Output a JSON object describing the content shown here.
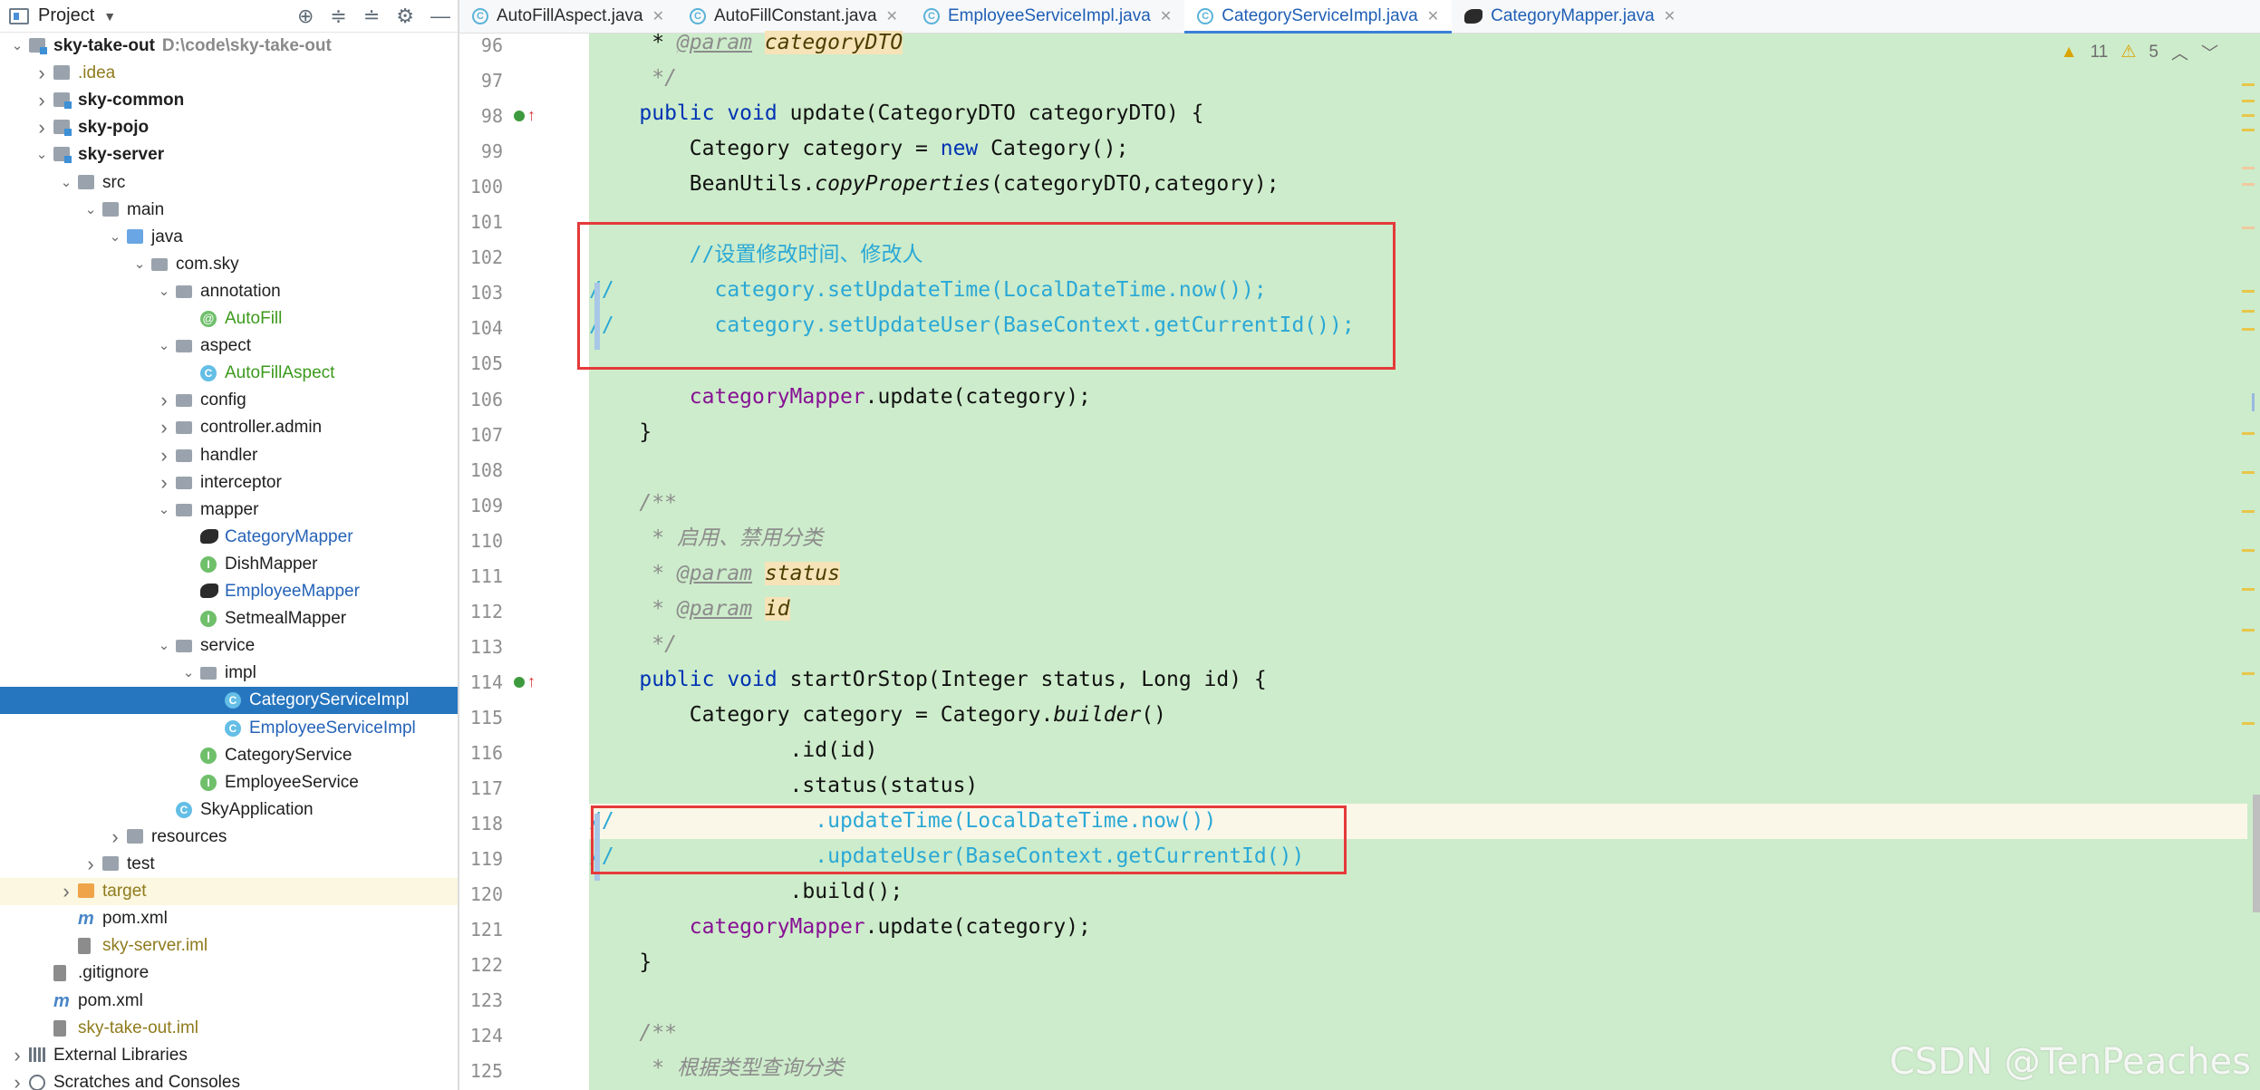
{
  "project_panel": {
    "title": "Project",
    "tree": [
      {
        "label": "sky-take-out",
        "path": "D:\\code\\sky-take-out",
        "indent": 0,
        "arrow": "down",
        "icon": "module-folder-icon",
        "style": "bold"
      },
      {
        "label": ".idea",
        "indent": 1,
        "arrow": "right",
        "icon": "folder-icon",
        "style": "brown"
      },
      {
        "label": "sky-common",
        "indent": 1,
        "arrow": "right",
        "icon": "module-folder-icon",
        "style": "bold"
      },
      {
        "label": "sky-pojo",
        "indent": 1,
        "arrow": "right",
        "icon": "module-folder-icon",
        "style": "bold"
      },
      {
        "label": "sky-server",
        "indent": 1,
        "arrow": "down",
        "icon": "module-folder-icon",
        "style": "bold"
      },
      {
        "label": "src",
        "indent": 2,
        "arrow": "down",
        "icon": "folder-icon",
        "style": ""
      },
      {
        "label": "main",
        "indent": 3,
        "arrow": "down",
        "icon": "folder-icon",
        "style": ""
      },
      {
        "label": "java",
        "indent": 4,
        "arrow": "down",
        "icon": "source-folder-icon",
        "style": ""
      },
      {
        "label": "com.sky",
        "indent": 5,
        "arrow": "down",
        "icon": "package-icon",
        "style": ""
      },
      {
        "label": "annotation",
        "indent": 6,
        "arrow": "down",
        "icon": "package-icon",
        "style": ""
      },
      {
        "label": "AutoFill",
        "indent": 7,
        "arrow": "",
        "icon": "annotation-icon",
        "style": "green"
      },
      {
        "label": "aspect",
        "indent": 6,
        "arrow": "down",
        "icon": "package-icon",
        "style": ""
      },
      {
        "label": "AutoFillAspect",
        "indent": 7,
        "arrow": "",
        "icon": "class-icon",
        "style": "green"
      },
      {
        "label": "config",
        "indent": 6,
        "arrow": "right",
        "icon": "package-icon",
        "style": ""
      },
      {
        "label": "controller.admin",
        "indent": 6,
        "arrow": "right",
        "icon": "package-icon",
        "style": ""
      },
      {
        "label": "handler",
        "indent": 6,
        "arrow": "right",
        "icon": "package-icon",
        "style": ""
      },
      {
        "label": "interceptor",
        "indent": 6,
        "arrow": "right",
        "icon": "package-icon",
        "style": ""
      },
      {
        "label": "mapper",
        "indent": 6,
        "arrow": "down",
        "icon": "package-icon",
        "style": ""
      },
      {
        "label": "CategoryMapper",
        "indent": 7,
        "arrow": "",
        "icon": "mybatis-icon",
        "style": "blue"
      },
      {
        "label": "DishMapper",
        "indent": 7,
        "arrow": "",
        "icon": "interface-icon",
        "style": ""
      },
      {
        "label": "EmployeeMapper",
        "indent": 7,
        "arrow": "",
        "icon": "mybatis-icon",
        "style": "blue"
      },
      {
        "label": "SetmealMapper",
        "indent": 7,
        "arrow": "",
        "icon": "interface-icon",
        "style": ""
      },
      {
        "label": "service",
        "indent": 6,
        "arrow": "down",
        "icon": "package-icon",
        "style": ""
      },
      {
        "label": "impl",
        "indent": 7,
        "arrow": "down",
        "icon": "package-icon",
        "style": ""
      },
      {
        "label": "CategoryServiceImpl",
        "indent": 8,
        "arrow": "",
        "icon": "class-icon",
        "style": "selected"
      },
      {
        "label": "EmployeeServiceImpl",
        "indent": 8,
        "arrow": "",
        "icon": "class-icon",
        "style": "blue"
      },
      {
        "label": "CategoryService",
        "indent": 7,
        "arrow": "",
        "icon": "interface-icon",
        "style": ""
      },
      {
        "label": "EmployeeService",
        "indent": 7,
        "arrow": "",
        "icon": "interface-icon",
        "style": ""
      },
      {
        "label": "SkyApplication",
        "indent": 6,
        "arrow": "",
        "icon": "spring-class-icon",
        "style": ""
      },
      {
        "label": "resources",
        "indent": 4,
        "arrow": "right",
        "icon": "resources-folder-icon",
        "style": ""
      },
      {
        "label": "test",
        "indent": 3,
        "arrow": "right",
        "icon": "folder-icon",
        "style": ""
      },
      {
        "label": "target",
        "indent": 2,
        "arrow": "right",
        "icon": "excluded-folder-icon",
        "style": "brown hl"
      },
      {
        "label": "pom.xml",
        "indent": 2,
        "arrow": "",
        "icon": "maven-icon",
        "style": ""
      },
      {
        "label": "sky-server.iml",
        "indent": 2,
        "arrow": "",
        "icon": "file-icon",
        "style": "brown"
      },
      {
        "label": ".gitignore",
        "indent": 1,
        "arrow": "",
        "icon": "file-icon",
        "style": ""
      },
      {
        "label": "pom.xml",
        "indent": 1,
        "arrow": "",
        "icon": "maven-icon",
        "style": ""
      },
      {
        "label": "sky-take-out.iml",
        "indent": 1,
        "arrow": "",
        "icon": "file-icon",
        "style": "brown"
      },
      {
        "label": "External Libraries",
        "indent": 0,
        "arrow": "right",
        "icon": "libraries-icon",
        "style": ""
      },
      {
        "label": "Scratches and Consoles",
        "indent": 0,
        "arrow": "right",
        "icon": "scratches-icon",
        "style": ""
      }
    ]
  },
  "tabs": [
    {
      "label": "AutoFillAspect.java",
      "icon": "class-icon",
      "active": false
    },
    {
      "label": "AutoFillConstant.java",
      "icon": "class-icon",
      "active": false
    },
    {
      "label": "EmployeeServiceImpl.java",
      "icon": "class-icon",
      "active": false
    },
    {
      "label": "CategoryServiceImpl.java",
      "icon": "class-icon",
      "active": true
    },
    {
      "label": "CategoryMapper.java",
      "icon": "mybatis-icon",
      "active": false
    }
  ],
  "inspections": {
    "warnings": "11",
    "weak_warnings": "5"
  },
  "lines": [
    {
      "n": "96",
      "html": "     * <span class='tag'>@param</span> <span class='param'>categoryDTO</span>"
    },
    {
      "n": "97",
      "html": "     <span class='cm'>*/</span>"
    },
    {
      "n": "98",
      "html": "    <span class='kw'>public void</span> update(CategoryDTO categoryDTO) {",
      "gutter": true
    },
    {
      "n": "99",
      "html": "        Category category = <span class='kw'>new</span> Category();"
    },
    {
      "n": "100",
      "html": "        BeanUtils.<span class='it'>copyProperties</span>(categoryDTO,category);"
    },
    {
      "n": "101",
      "html": ""
    },
    {
      "n": "102",
      "html": "        <span class='cmt'>//设置修改时间、修改人</span>"
    },
    {
      "n": "103",
      "html": "<span class='cmt'>//        category.setUpdateTime(LocalDateTime.now());</span>"
    },
    {
      "n": "104",
      "html": "<span class='cmt'>//        category.setUpdateUser(BaseContext.getCurrentId());</span>"
    },
    {
      "n": "105",
      "html": ""
    },
    {
      "n": "106",
      "html": "        <span class='field'>categoryMapper</span>.update(category);"
    },
    {
      "n": "107",
      "html": "    }"
    },
    {
      "n": "108",
      "html": ""
    },
    {
      "n": "109",
      "html": "    <span class='cm'>/**</span>"
    },
    {
      "n": "110",
      "html": "     <span class='cm'>* 启用、禁用分类</span>"
    },
    {
      "n": "111",
      "html": "     <span class='cm'>* </span><span class='tag'>@param</span> <span class='param'>status</span>"
    },
    {
      "n": "112",
      "html": "     <span class='cm'>* </span><span class='tag'>@param</span> <span class='param'>id</span>"
    },
    {
      "n": "113",
      "html": "     <span class='cm'>*/</span>"
    },
    {
      "n": "114",
      "html": "    <span class='kw'>public void</span> startOrStop(Integer status, Long id) {",
      "gutter": true
    },
    {
      "n": "115",
      "html": "        Category category = Category.<span class='it'>builder</span>()"
    },
    {
      "n": "116",
      "html": "                .id(id)"
    },
    {
      "n": "117",
      "html": "                .status(status)"
    },
    {
      "n": "118",
      "html": "<span class='cmt'>//                .updateTime(LocalDateTime.now())</span>"
    },
    {
      "n": "119",
      "html": "<span class='cmt'>//                .updateUser(BaseContext.getCurrentId())</span>"
    },
    {
      "n": "120",
      "html": "                .build();"
    },
    {
      "n": "121",
      "html": "        <span class='field'>categoryMapper</span>.update(category);"
    },
    {
      "n": "122",
      "html": "    }"
    },
    {
      "n": "123",
      "html": ""
    },
    {
      "n": "124",
      "html": "    <span class='cm'>/**</span>"
    },
    {
      "n": "125",
      "html": "     <span class='cm'>* 根据类型查询分类</span>"
    }
  ],
  "watermark": "CSDN @TenPeaches"
}
